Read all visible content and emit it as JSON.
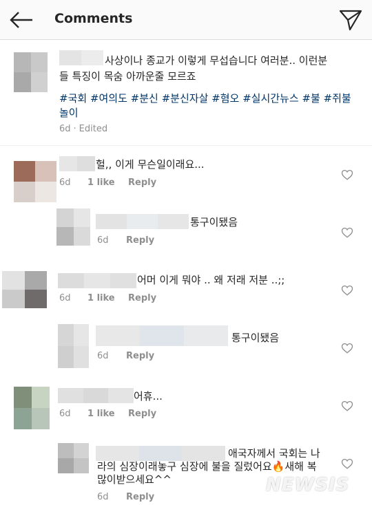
{
  "header": {
    "title": "Comments",
    "back_icon": "arrow-left-icon",
    "send_icon": "paper-plane-icon"
  },
  "caption": {
    "text": "사상이나 종교가 이렇게 무섭습니다 여러분.. 이런분들 특징이 목숨 아까운줄 모르죠",
    "text_line1": "사상이나 종교가 이렇게 무섭습니다 여러분.. 이런분",
    "text_line2": "들 특징이 목숨 아까운줄 모르죠",
    "hashtags": [
      "#국회",
      "#여의도",
      "#분신",
      "#분신자살",
      "#혐오",
      "#실시간뉴스",
      "#불",
      "#쥐불놀이"
    ],
    "hashtags_line1": "#국회 #여의도 #분신 #분신자살 #혐오 #실시간뉴스 #불 #쥐불",
    "hashtags_line2": "놀이",
    "time": "6d",
    "edited": "Edited"
  },
  "comments": [
    {
      "text": "헐,, 이게 무슨일이래요...",
      "time": "6d",
      "likes": "1 like",
      "reply": "Reply"
    },
    {
      "text": "통구이됐음",
      "time": "6d",
      "reply": "Reply"
    },
    {
      "text": "어머 이게 뭐야 .. 왜 저래 저분 ..;;",
      "time": "6d",
      "likes": "1 like",
      "reply": "Reply"
    },
    {
      "text": "통구이됐음",
      "time": "6d",
      "reply": "Reply"
    },
    {
      "text": "어휴...",
      "time": "6d",
      "likes": "1 like",
      "reply": "Reply"
    },
    {
      "text_line1": "애국자께서 국회는 나",
      "text_line2": "라의 심장이래놓구 심장에 불을 질렀어요🔥새해 복",
      "text_line3": "많이받으세요^^",
      "time": "6d",
      "reply": "Reply"
    }
  ],
  "watermark": "NEWSIS",
  "colors": {
    "hashtag": "#003569",
    "meta": "#8e8e8e",
    "text": "#262626",
    "header_bg": "#fafafa"
  }
}
